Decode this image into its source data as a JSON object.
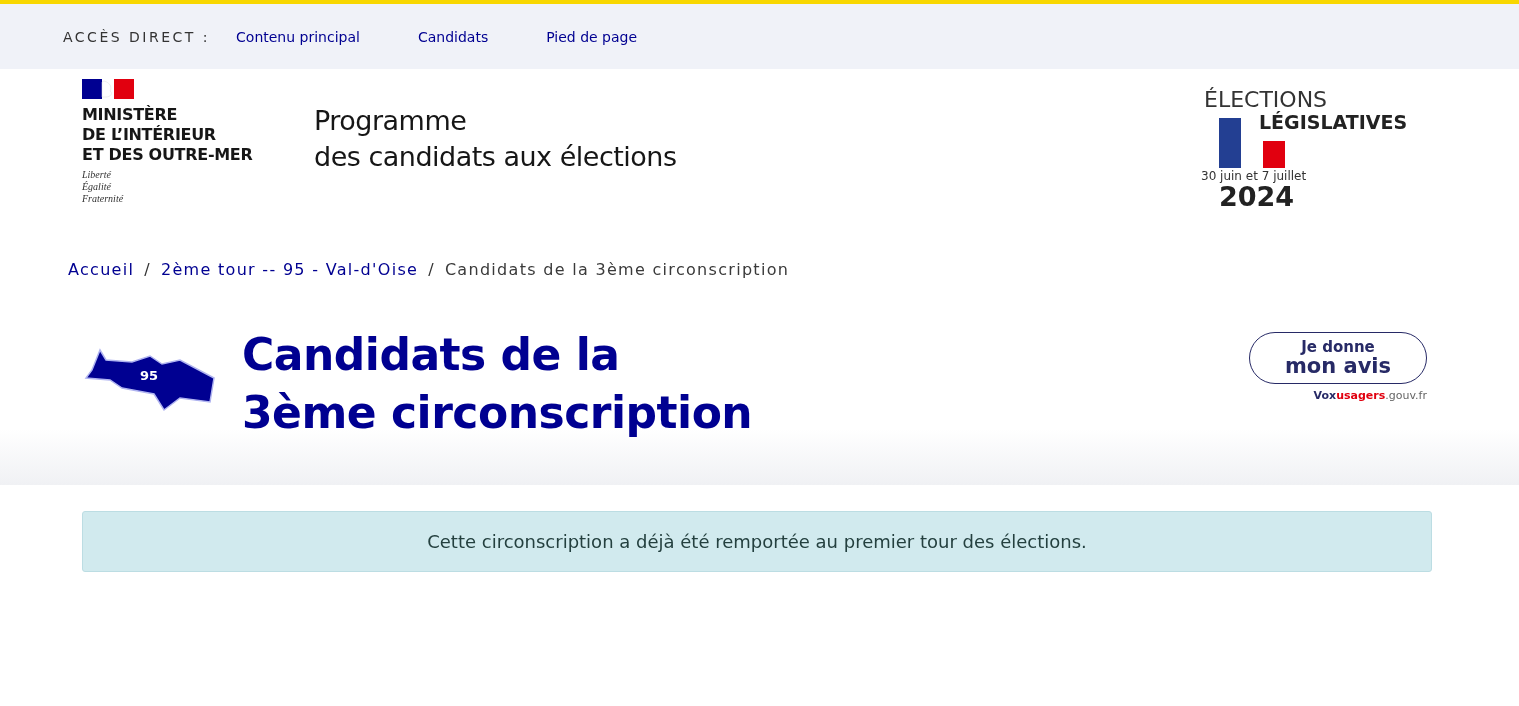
{
  "skip_links": {
    "label": "ACCÈS DIRECT :",
    "links": [
      "Contenu principal",
      "Candidats",
      "Pied de page"
    ]
  },
  "header": {
    "ministry": [
      "MINISTÈRE",
      "DE L’INTÉRIEUR",
      "ET DES OUTRE-MER"
    ],
    "motto": [
      "Liberté",
      "Égalité",
      "Fraternité"
    ],
    "service_title": [
      "Programme",
      "des candidats aux élections"
    ],
    "election_logo": {
      "line_1": "ÉLECTIONS",
      "line_2": "LÉGISLATIVES",
      "dates": "30 juin et 7 juillet",
      "year": "2024"
    }
  },
  "breadcrumb_separator": "/",
  "breadcrumb": [
    {
      "label": "Accueil",
      "current": false
    },
    {
      "label": "2ème tour -- 95 - Val-d'Oise",
      "current": false
    },
    {
      "label": "Candidats de la 3ème circonscription",
      "current": true
    }
  ],
  "page": {
    "department_badge": "95",
    "title": [
      "Candidats de la",
      "3ème circonscription"
    ],
    "feedback": {
      "line_1": "Je donne",
      "line_2": "mon avis",
      "site": [
        "Vox",
        "usagers",
        ".gouv.fr"
      ]
    }
  },
  "alert": "Cette circonscription a déjà été remportée au premier tour des élections."
}
